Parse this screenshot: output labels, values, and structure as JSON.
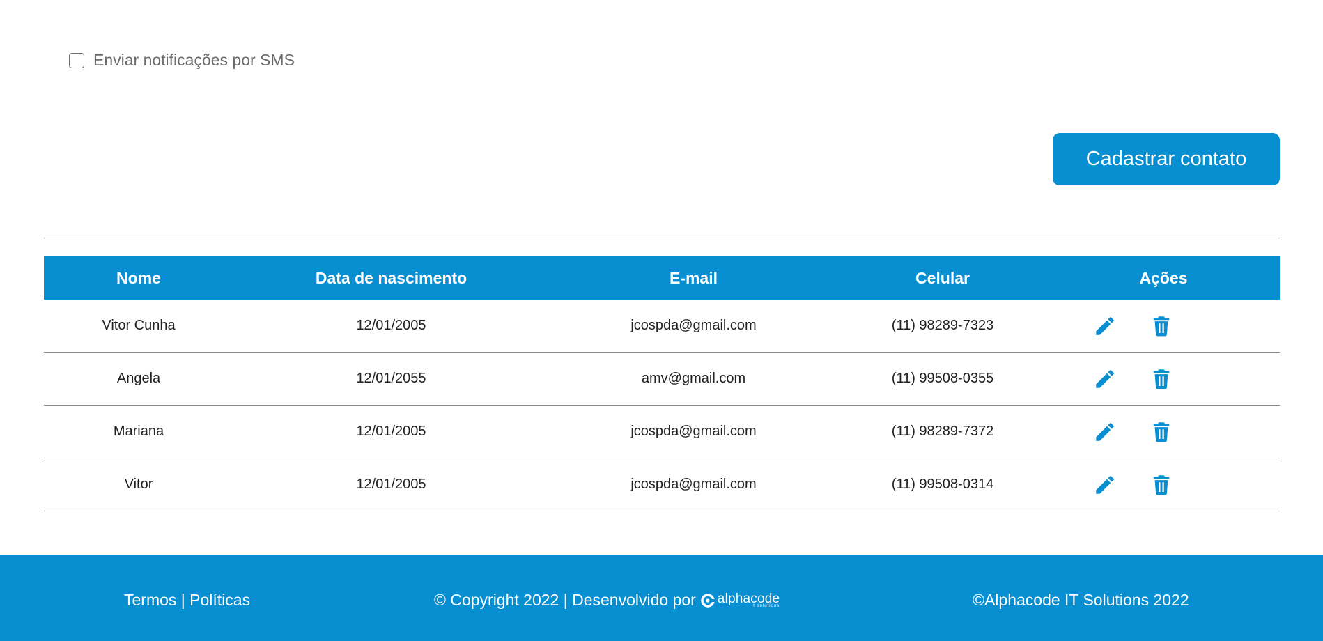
{
  "form": {
    "sms_label": "Enviar notificações por SMS",
    "sms_checked": false,
    "submit_label": "Cadastrar contato"
  },
  "table": {
    "headers": {
      "nome": "Nome",
      "nascimento": "Data de nascimento",
      "email": "E-mail",
      "celular": "Celular",
      "acoes": "Ações"
    },
    "rows": [
      {
        "nome": "Vitor Cunha",
        "nascimento": "12/01/2005",
        "email": "jcospda@gmail.com",
        "celular": "(11) 98289-7323"
      },
      {
        "nome": "Angela",
        "nascimento": "12/01/2055",
        "email": "amv@gmail.com",
        "celular": "(11) 99508-0355"
      },
      {
        "nome": "Mariana",
        "nascimento": "12/01/2005",
        "email": "jcospda@gmail.com",
        "celular": "(11) 98289-7372"
      },
      {
        "nome": "Vitor",
        "nascimento": "12/01/2005",
        "email": "jcospda@gmail.com",
        "celular": "(11) 99508-0314"
      }
    ],
    "row_icons": {
      "edit": "pencil-icon",
      "delete": "trash-icon"
    }
  },
  "footer": {
    "termos": "Termos",
    "separator": "|",
    "politicas": "Políticas",
    "copyright": "© Copyright 2022 | Desenvolvido por",
    "logo_word": "alphacode",
    "logo_sub": "it solutions",
    "company": "©Alphacode IT Solutions 2022"
  },
  "colors": {
    "primary": "#078fd2",
    "text": "#222222",
    "muted": "#6b6b6b",
    "divider": "#8c8c8c"
  }
}
